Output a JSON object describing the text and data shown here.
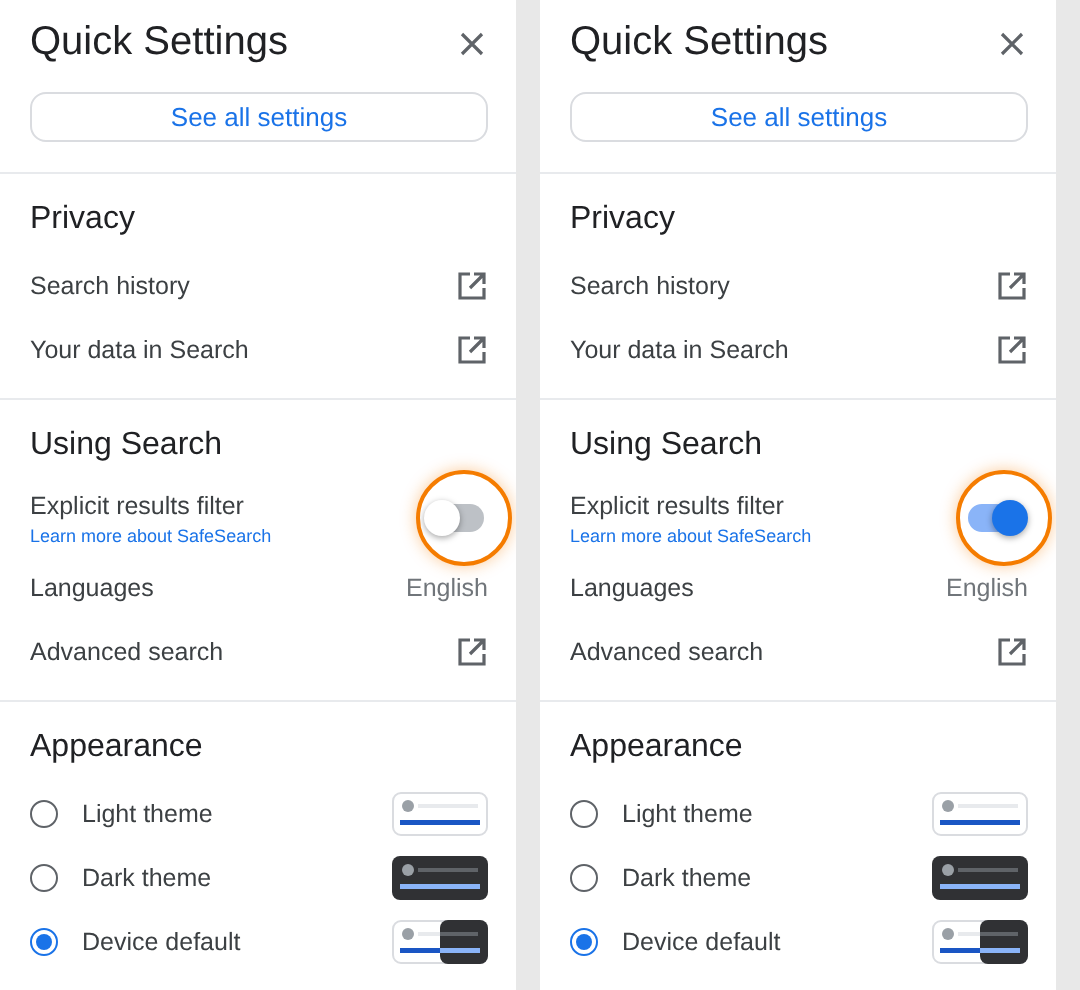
{
  "panels": [
    {
      "title": "Quick Settings",
      "button": "See all settings",
      "sections": [
        {
          "heading": "Privacy",
          "rows": [
            {
              "kind": "link",
              "label": "Search history"
            },
            {
              "kind": "link",
              "label": "Your data in Search"
            }
          ]
        },
        {
          "heading": "Using Search",
          "rows": [
            {
              "kind": "toggle",
              "label": "Explicit results filter",
              "sublink": "Learn more about SafeSearch",
              "on": false,
              "highlighted": true
            },
            {
              "kind": "value",
              "label": "Languages",
              "value": "English"
            },
            {
              "kind": "link",
              "label": "Advanced search"
            }
          ]
        },
        {
          "heading": "Appearance",
          "rows": [
            {
              "kind": "light_theme",
              "label": "Light theme",
              "selected": false
            },
            {
              "kind": "dark_theme",
              "label": "Dark theme",
              "selected": false
            },
            {
              "kind": "device_theme",
              "label": "Device default",
              "selected": true
            }
          ]
        }
      ]
    },
    {
      "title": "Quick Settings",
      "button": "See all settings",
      "sections": [
        {
          "heading": "Privacy",
          "rows": [
            {
              "kind": "link",
              "label": "Search history"
            },
            {
              "kind": "link",
              "label": "Your data in Search"
            }
          ]
        },
        {
          "heading": "Using Search",
          "rows": [
            {
              "kind": "toggle",
              "label": "Explicit results filter",
              "sublink": "Learn more about SafeSearch",
              "on": true,
              "highlighted": true
            },
            {
              "kind": "value",
              "label": "Languages",
              "value": "English"
            },
            {
              "kind": "link",
              "label": "Advanced search"
            }
          ]
        },
        {
          "heading": "Appearance",
          "rows": [
            {
              "kind": "light_theme",
              "label": "Light theme",
              "selected": false
            },
            {
              "kind": "dark_theme",
              "label": "Dark theme",
              "selected": false
            },
            {
              "kind": "device_theme",
              "label": "Device default",
              "selected": true
            }
          ]
        }
      ]
    }
  ]
}
